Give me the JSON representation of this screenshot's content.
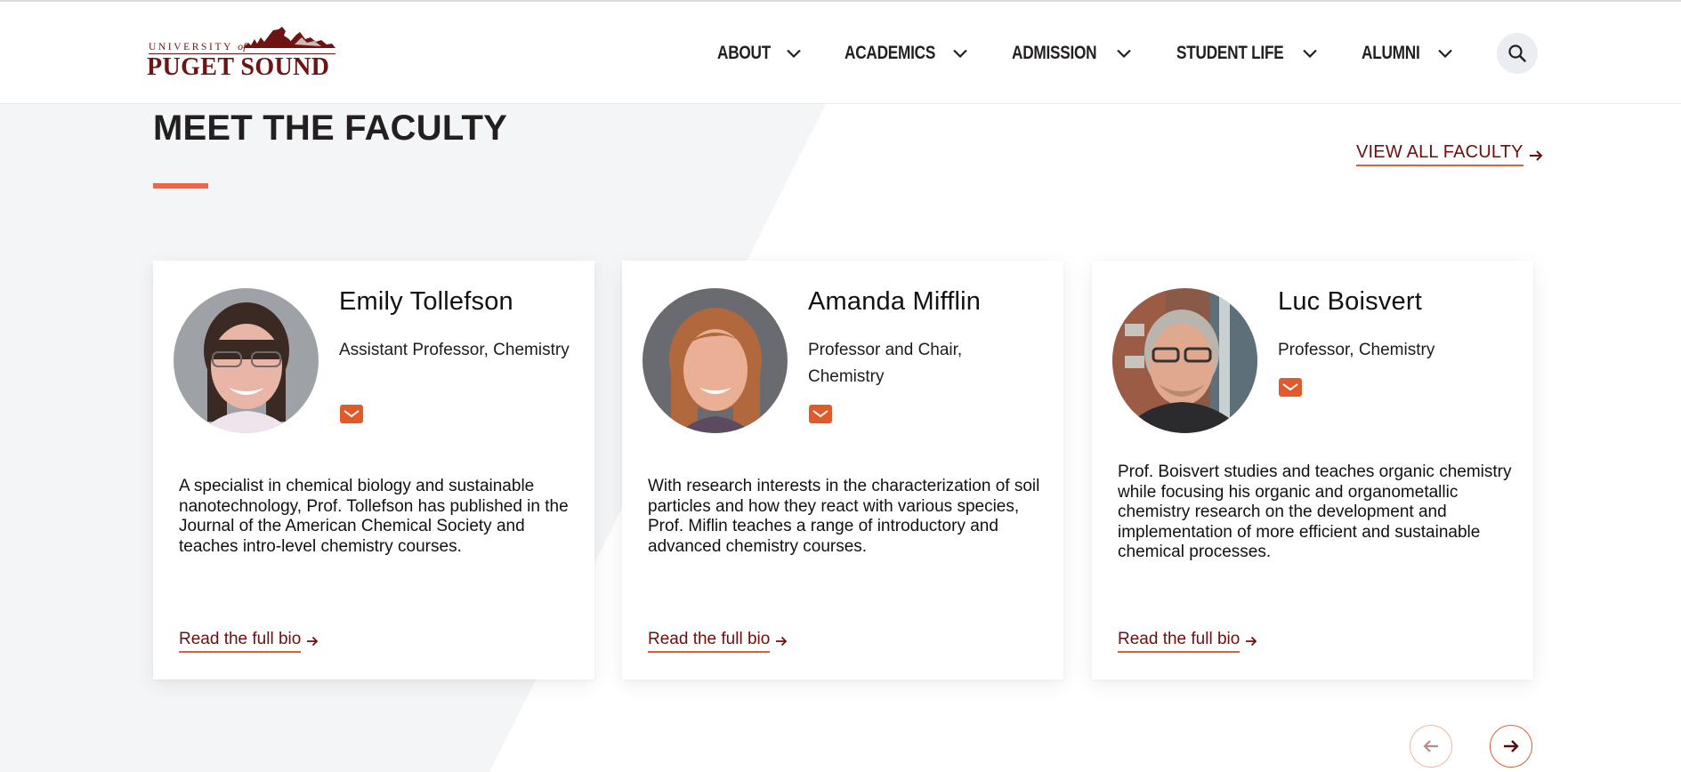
{
  "header": {
    "logo": {
      "line1": "UNIVERSITY",
      "line1_of": "of",
      "line2": "PUGET SOUND",
      "alt": "University of Puget Sound"
    },
    "nav": [
      {
        "label": "ABOUT",
        "icon": "chevron-down-icon"
      },
      {
        "label": "ACADEMICS",
        "icon": "chevron-down-icon"
      },
      {
        "label": "ADMISSION",
        "icon": "chevron-down-icon"
      },
      {
        "label": "STUDENT LIFE",
        "icon": "chevron-down-icon"
      },
      {
        "label": "ALUMNI",
        "icon": "chevron-down-icon"
      }
    ],
    "search_icon": "search-icon"
  },
  "section": {
    "title": "MEET THE FACULTY",
    "view_all_label": "VIEW ALL FACULTY",
    "view_all_icon": "arrow-right-icon"
  },
  "faculty": [
    {
      "name": "Emily Tollefson",
      "role": "Assistant Professor, Chemistry",
      "email_icon": "mail-icon",
      "bio": "A specialist in chemical biology and sustainable nanotechnology, Prof. Tollefson has published in the Journal of the American Chemical Society and teaches intro-level chemistry courses.",
      "link_label": "Read the full bio"
    },
    {
      "name": "Amanda Mifflin",
      "role": "Professor and Chair, Chemistry",
      "email_icon": "mail-icon",
      "bio": "With research interests in the characterization of soil particles and how they react with various species, Prof. Miflin teaches a range of introductory and advanced chemistry courses.",
      "link_label": "Read the full bio"
    },
    {
      "name": "Luc Boisvert",
      "role": "Professor, Chemistry",
      "email_icon": "mail-icon",
      "bio": "Prof. Boisvert studies and teaches organic chemistry while focusing his organic and organometallic chemistry research on the development and implementation of more efficient and sustainable chemical processes.",
      "link_label": "Read the full bio"
    }
  ],
  "carousel": {
    "prev_icon": "arrow-left-icon",
    "next_icon": "arrow-right-icon"
  },
  "colors": {
    "brand_maroon": "#6b0f0f",
    "accent_orange": "#f2644a",
    "link_underline": "#d9603b",
    "email_button": "#e05a2b",
    "section_bg": "#f4f5f7",
    "search_bg": "#eaedf2"
  }
}
